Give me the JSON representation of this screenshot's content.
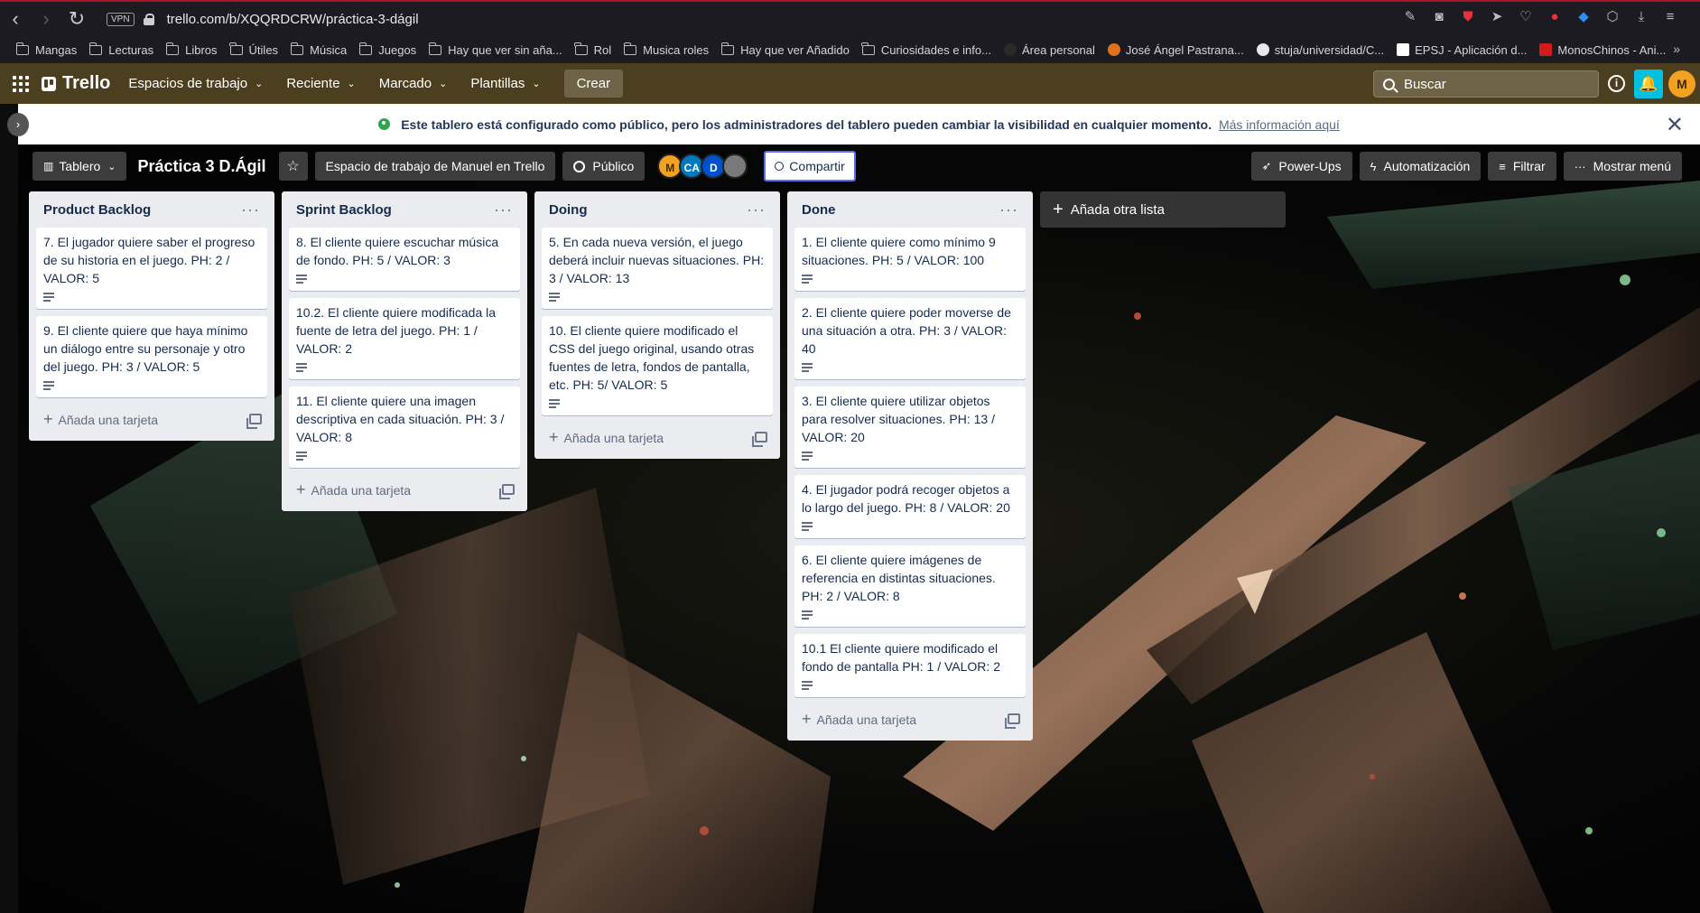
{
  "browser": {
    "url": "trello.com/b/XQQRDCRW/práctica-3-dágil",
    "vpn_label": "VPN",
    "bookmarks": [
      "Mangas",
      "Lecturas",
      "Libros",
      "Útiles",
      "Música",
      "Juegos",
      "Hay que ver sin aña...",
      "Rol",
      "Musica roles",
      "Hay que ver Añadido",
      "Curiosidades e info...",
      "Área personal",
      "José Ángel Pastrana...",
      "stuja/universidad/C...",
      "EPSJ - Aplicación d...",
      "MonosChinos - Ani..."
    ],
    "more_label": "»"
  },
  "header": {
    "logo": "Trello",
    "menus": [
      "Espacios de trabajo",
      "Reciente",
      "Marcado",
      "Plantillas"
    ],
    "create": "Crear",
    "search_placeholder": "Buscar",
    "user_initial": "M"
  },
  "banner": {
    "message": "Este tablero está configurado como público, pero los administradores del tablero pueden cambiar la visibilidad en cualquier momento.",
    "link": "Más información aquí",
    "close": "✕"
  },
  "board": {
    "view": "Tablero",
    "title": "Práctica 3 D.Ágil",
    "workspace": "Espacio de trabajo de Manuel en Trello",
    "visibility": "Público",
    "members": [
      {
        "initials": "M",
        "color": "#f2a123"
      },
      {
        "initials": "CA",
        "color": "#0079bf"
      },
      {
        "initials": "D",
        "color": "#0052cc"
      },
      {
        "initials": "",
        "color": "#7a7a7a"
      }
    ],
    "share": "Compartir",
    "power_ups": "Power-Ups",
    "automation": "Automatización",
    "filter": "Filtrar",
    "show_menu": "Mostrar menú"
  },
  "lists": [
    {
      "title": "Product Backlog",
      "cards": [
        "7. El jugador quiere saber el progreso de su historia en el juego. PH: 2 / VALOR: 5",
        "9. El cliente quiere que haya mínimo un diálogo entre su personaje y otro del juego. PH: 3 / VALOR: 5"
      ],
      "add_card": "Añada una tarjeta"
    },
    {
      "title": "Sprint Backlog",
      "cards": [
        "8. El cliente quiere escuchar música de fondo. PH: 5 / VALOR: 3",
        "10.2. El cliente quiere modificada la fuente de letra del juego. PH: 1 / VALOR: 2",
        "11. El cliente quiere una imagen descriptiva en cada situación. PH: 3 / VALOR: 8"
      ],
      "add_card": "Añada una tarjeta"
    },
    {
      "title": "Doing",
      "cards": [
        "5. En cada nueva versión, el juego deberá incluir nuevas situaciones. PH: 3 / VALOR: 13",
        "10. El cliente quiere modificado el CSS del juego original, usando otras fuentes de letra, fondos de pantalla, etc. PH: 5/ VALOR: 5"
      ],
      "add_card": "Añada una tarjeta"
    },
    {
      "title": "Done",
      "cards": [
        "1. El cliente quiere como mínimo 9 situaciones. PH: 5 / VALOR: 100",
        "2. El cliente quiere poder moverse de una situación a otra. PH: 3 / VALOR: 40",
        "3. El cliente quiere utilizar objetos para resolver situaciones. PH: 13 / VALOR: 20",
        "4. El jugador podrá recoger objetos a lo largo del juego. PH: 8 / VALOR: 20",
        "6. El cliente quiere imágenes de referencia en distintas situaciones. PH: 2 / VALOR: 8",
        "10.1 El cliente quiere modificado el fondo de pantalla PH: 1 / VALOR: 2"
      ],
      "add_card": "Añada una tarjeta"
    }
  ],
  "add_list": "Añada otra lista",
  "colors": {
    "header_bg": "#4b3f1f",
    "accent_notify": "#00c2e0",
    "list_bg": "#ebecf0"
  }
}
